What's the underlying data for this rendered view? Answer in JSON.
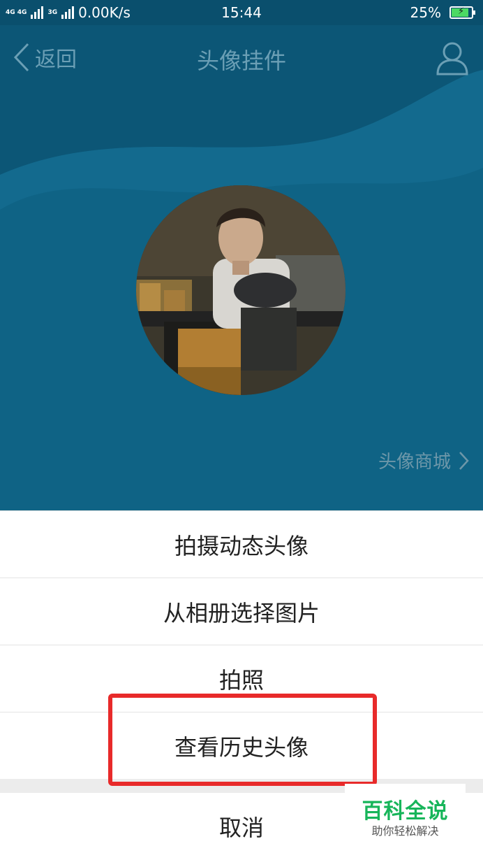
{
  "status_bar": {
    "network": "4G 4G",
    "network2": "3G",
    "speed": "0.00K/s",
    "time": "15:44",
    "battery": "25%"
  },
  "header": {
    "back_label": "返回",
    "title": "头像挂件"
  },
  "shop_link": "头像商城",
  "sheet": {
    "items": [
      "拍摄动态头像",
      "从相册选择图片",
      "拍照",
      "查看历史头像"
    ],
    "cancel": "取消"
  },
  "watermark": {
    "title": "百科全说",
    "subtitle": "助你轻松解决"
  },
  "colors": {
    "header_bg": "#0f6385",
    "highlight": "#e82a2a",
    "watermark_green": "#17b55a"
  }
}
